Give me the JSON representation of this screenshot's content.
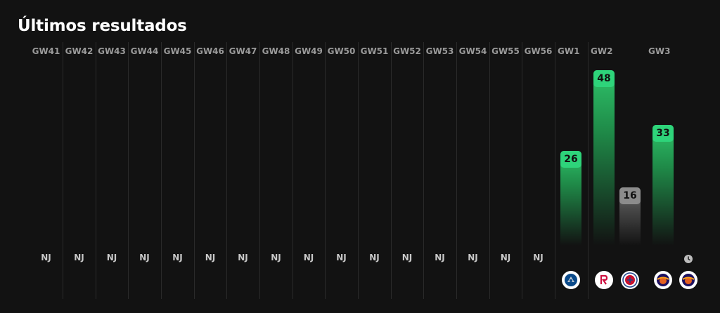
{
  "title": "Últimos resultados",
  "gameweeks": [
    {
      "label": "GW41",
      "result": "NJ"
    },
    {
      "label": "GW42",
      "result": "NJ"
    },
    {
      "label": "GW43",
      "result": "NJ"
    },
    {
      "label": "GW44",
      "result": "NJ"
    },
    {
      "label": "GW45",
      "result": "NJ"
    },
    {
      "label": "GW46",
      "result": "NJ"
    },
    {
      "label": "GW47",
      "result": "NJ"
    },
    {
      "label": "GW48",
      "result": "NJ"
    },
    {
      "label": "GW49",
      "result": "NJ"
    },
    {
      "label": "GW50",
      "result": "NJ"
    },
    {
      "label": "GW51",
      "result": "NJ"
    },
    {
      "label": "GW52",
      "result": "NJ"
    },
    {
      "label": "GW53",
      "result": "NJ"
    },
    {
      "label": "GW54",
      "result": "NJ"
    },
    {
      "label": "GW55",
      "result": "NJ"
    },
    {
      "label": "GW56",
      "result": "NJ"
    },
    {
      "label": "GW1"
    },
    {
      "label": "GW2"
    },
    {
      "label": "GW3"
    }
  ],
  "chart_data": {
    "type": "bar",
    "ylim": [
      0,
      55
    ],
    "bars": [
      {
        "gameweek": "GW1",
        "value": 26,
        "status": "positive",
        "opponent_icon": "dallas-mavericks-logo-icon"
      },
      {
        "gameweek": "GW2",
        "value": 48,
        "status": "positive",
        "opponent_icon": "houston-rockets-logo-icon"
      },
      {
        "gameweek": "GW2",
        "value": 16,
        "status": "neutral",
        "opponent_icon": "la-clippers-logo-icon"
      },
      {
        "gameweek": "GW3",
        "value": 33,
        "status": "positive",
        "opponent_icon": "phoenix-suns-logo-icon"
      }
    ],
    "pending": {
      "gameweek": "GW3",
      "icon": "clock-icon",
      "opponent_icon": "phoenix-suns-logo-icon"
    }
  },
  "colors": {
    "background": "#121212",
    "positive": "#2ed47a",
    "neutral": "#8c8c8c",
    "gw_label": "#9a9a9a"
  }
}
